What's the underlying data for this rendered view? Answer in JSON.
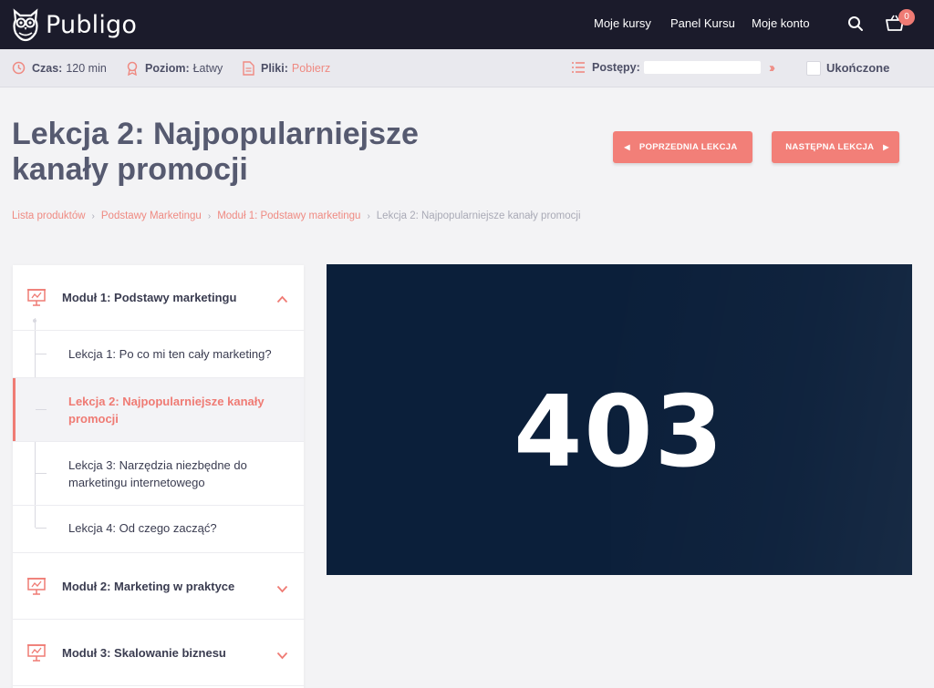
{
  "brand": {
    "name": "Publigo"
  },
  "nav": {
    "links": [
      "Moje kursy",
      "Panel Kursu",
      "Moje konto"
    ],
    "cart_count": "0"
  },
  "info": {
    "time_label": "Czas:",
    "time_value": "120 min",
    "level_label": "Poziom:",
    "level_value": "Łatwy",
    "files_label": "Pliki:",
    "files_link": "Pobierz",
    "progress_label": "Postępy:",
    "completed_label": "Ukończone",
    "completed_checked": false
  },
  "page": {
    "title": "Lekcja 2: Najpopularniejsze kanały promocji",
    "prev_button": "POPRZEDNIA LEKCJA",
    "next_button": "NASTĘPNA LEKCJA"
  },
  "breadcrumb": {
    "items": [
      "Lista produktów",
      "Podstawy Marketingu",
      "Moduł 1: Podstawy marketingu"
    ],
    "current": "Lekcja 2: Najpopularniejsze kanały promocji"
  },
  "sidebar": {
    "modules": [
      {
        "label": "Moduł 1: Podstawy marketingu",
        "expanded": true
      },
      {
        "label": "Moduł 2: Marketing w praktyce",
        "expanded": false
      },
      {
        "label": "Moduł 3: Skalowanie biznesu",
        "expanded": false
      }
    ],
    "lessons": [
      {
        "label": "Lekcja 1: Po co mi ten cały marketing?",
        "active": false
      },
      {
        "label": "Lekcja 2: Najpopularniejsze kanały promocji",
        "active": true
      },
      {
        "label": "Lekcja 3: Narzędzia niezbędne do marketingu internetowego",
        "active": false
      },
      {
        "label": "Lekcja 4: Od czego zacząć?",
        "active": false
      }
    ]
  },
  "video": {
    "error_code": "403"
  },
  "colors": {
    "accent": "#ef7b74",
    "nav_bg": "#1b1b2b",
    "video_bg": "#0b1f3a",
    "title": "#565a70"
  },
  "icons": {
    "logo": "owl-icon",
    "search": "search-icon",
    "cart": "basket-icon",
    "time": "clock-icon",
    "level": "medal-icon",
    "files": "file-icon",
    "progress": "list-icon",
    "module": "presentation-icon"
  }
}
